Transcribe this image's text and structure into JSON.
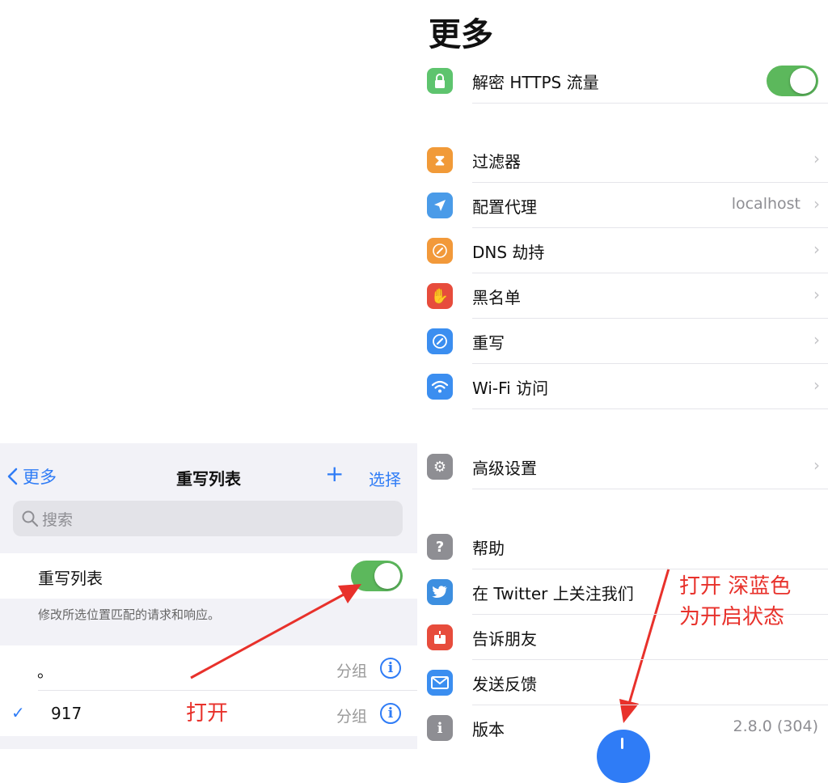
{
  "left_panel": {
    "nav": {
      "back_label": "更多",
      "title": "重写列表",
      "plus": "+",
      "select": "选择"
    },
    "search": {
      "placeholder": "搜索"
    },
    "toggle_row": {
      "label": "重写列表",
      "enabled": true
    },
    "description": "修改所选位置匹配的请求和响应。",
    "list": [
      {
        "name": "。",
        "checked": false,
        "group": "分组"
      },
      {
        "name": "917",
        "checked": true,
        "group": "分组"
      }
    ],
    "annotation": "打开"
  },
  "right_panel": {
    "title": "更多",
    "https_row": {
      "label": "解密 HTTPS 流量",
      "enabled": true,
      "icon": "lock-icon",
      "color": "#5ec46e"
    },
    "items": [
      {
        "label": "过滤器",
        "icon": "hourglass-icon",
        "color": "#f19a38",
        "value": ""
      },
      {
        "label": "配置代理",
        "icon": "paper-plane-icon",
        "color": "#4a9be8",
        "value": "localhost"
      },
      {
        "label": "DNS 劫持",
        "icon": "link-icon",
        "color": "#f2993a",
        "value": ""
      },
      {
        "label": "黑名单",
        "icon": "hand-icon",
        "color": "#e74c3c",
        "value": ""
      },
      {
        "label": "重写",
        "icon": "compass-icon",
        "color": "#3b8ef0",
        "value": ""
      },
      {
        "label": "Wi-Fi 访问",
        "icon": "wifi-icon",
        "color": "#3b8ef0",
        "value": ""
      }
    ],
    "advanced": {
      "label": "高级设置",
      "icon": "gear-icon",
      "color": "#8e8e93"
    },
    "bottom_items": [
      {
        "label": "帮助",
        "icon": "question-icon",
        "color": "#8e8e93",
        "value": ""
      },
      {
        "label": "在 Twitter 上关注我们",
        "icon": "twitter-icon",
        "color": "#3d8fe0",
        "value": ""
      },
      {
        "label": "告诉朋友",
        "icon": "share-icon",
        "color": "#e74c3c",
        "value": ""
      },
      {
        "label": "发送反馈",
        "icon": "mail-icon",
        "color": "#3b8ef0",
        "value": ""
      },
      {
        "label": "版本",
        "icon": "info-icon",
        "color": "#8e8e93",
        "value": "2.8.0 (304)"
      }
    ],
    "annotation_line1": "打开 深蓝色",
    "annotation_line2": "为开启状态"
  }
}
